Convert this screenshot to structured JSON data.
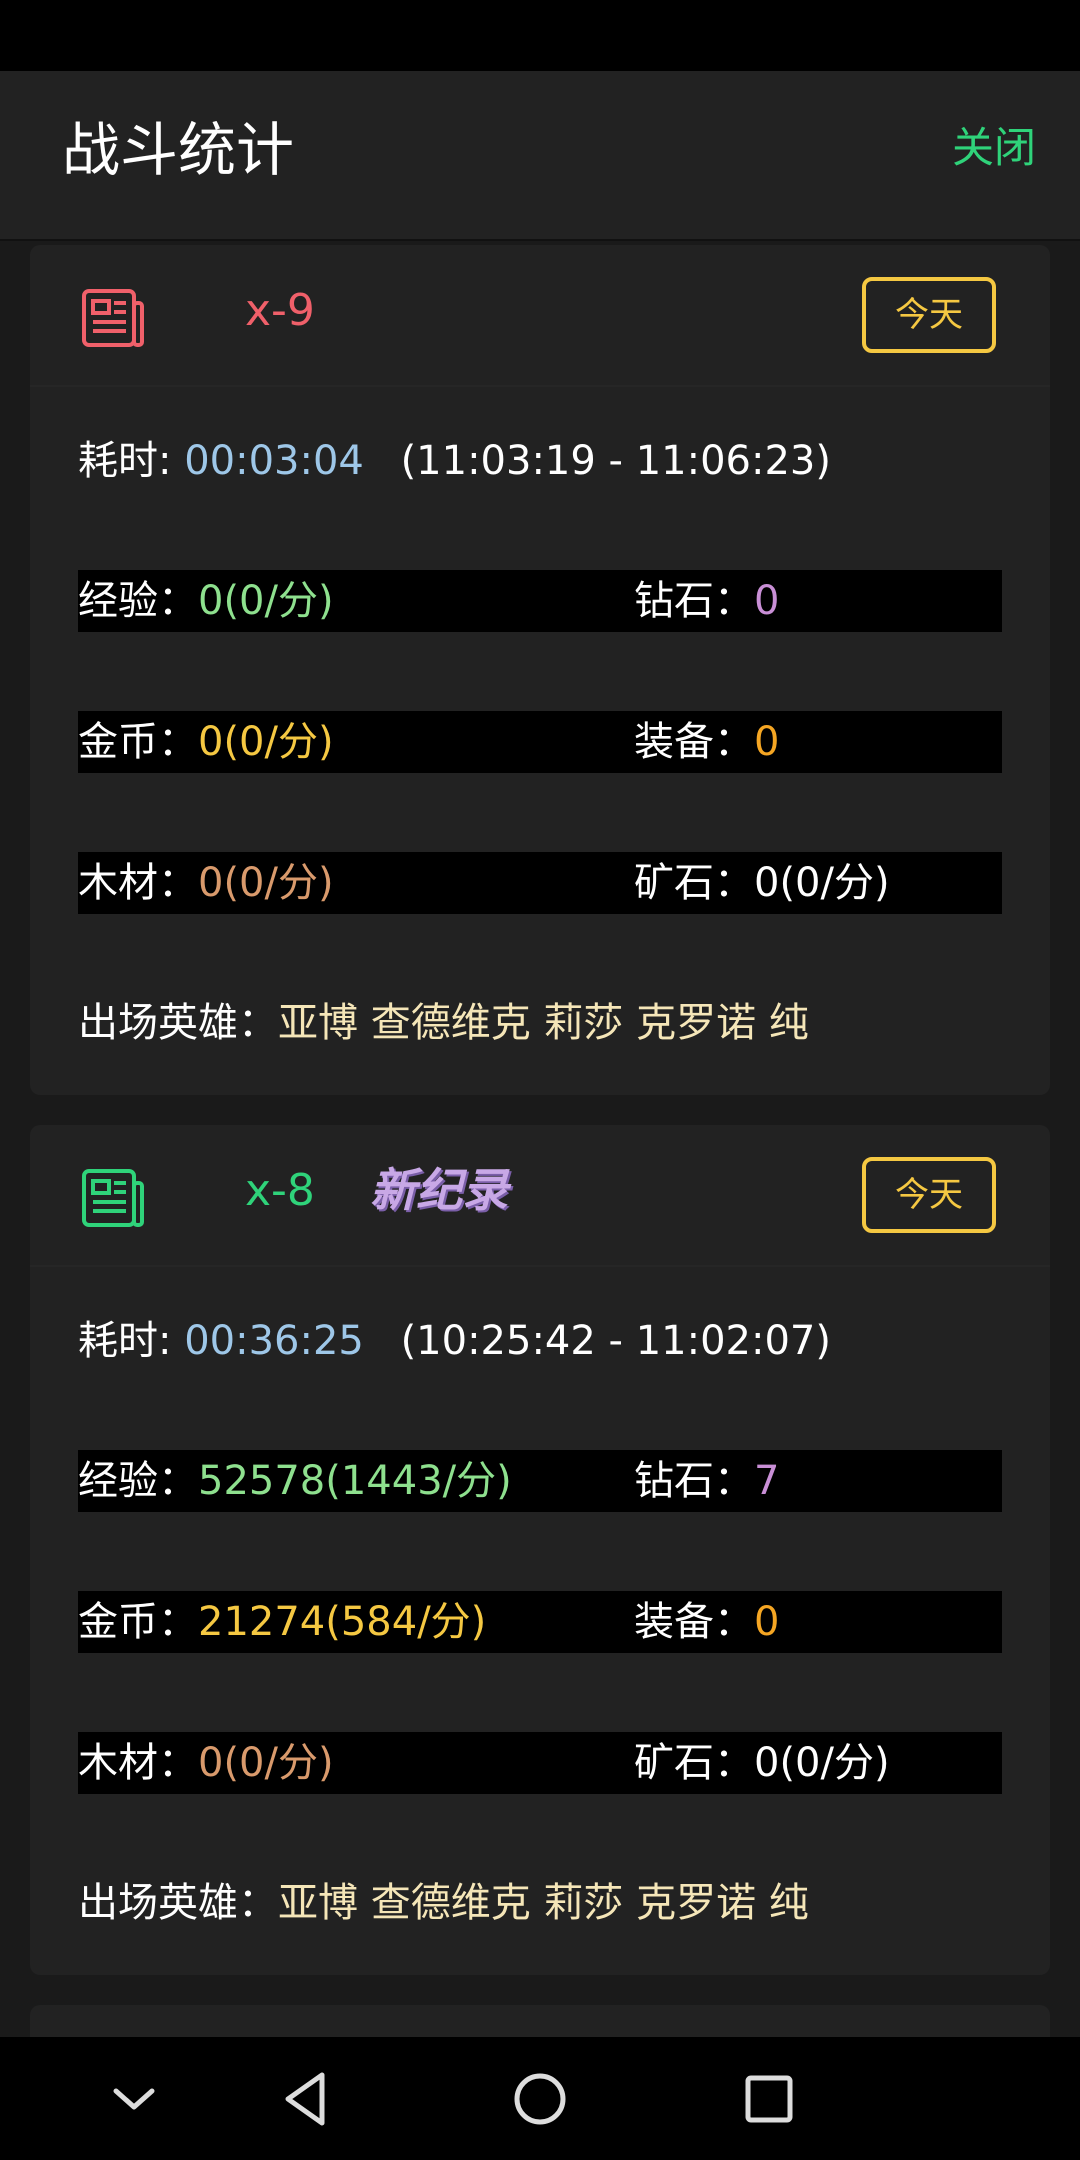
{
  "header": {
    "title": "战斗统计",
    "close_label": "关闭"
  },
  "colors": {
    "accent_green": "#2fd37a",
    "level_red": "#f0606a",
    "today_yellow": "#f5c842"
  },
  "cards": [
    {
      "icon": "document-icon",
      "icon_color": "#f0606a",
      "level": "x-9",
      "record_badge": "",
      "today_label": "今天",
      "time_label": "耗时:",
      "duration": "00:03:04",
      "range": "(11:03:19 - 11:06:23)",
      "exp_label": "经验：",
      "exp_value": "0(0/分)",
      "diamond_label": "钻石：",
      "diamond_value": "0",
      "gold_label": "金币：",
      "gold_value": "0(0/分)",
      "equip_label": "装备：",
      "equip_value": "0",
      "wood_label": "木材：",
      "wood_value": "0(0/分)",
      "ore_label": "矿石：",
      "ore_value": "0(0/分)",
      "heroes_label": "出场英雄：",
      "heroes": "亚博 查德维克 莉莎 克罗诺 纯"
    },
    {
      "icon": "document-icon",
      "icon_color": "#2fd37a",
      "level": "x-8",
      "record_badge": "新纪录",
      "today_label": "今天",
      "time_label": "耗时:",
      "duration": "00:36:25",
      "range": "(10:25:42 - 11:02:07)",
      "exp_label": "经验：",
      "exp_value": "52578(1443/分)",
      "diamond_label": "钻石：",
      "diamond_value": "7",
      "gold_label": "金币：",
      "gold_value": "21274(584/分)",
      "equip_label": "装备：",
      "equip_value": "0",
      "wood_label": "木材：",
      "wood_value": "0(0/分)",
      "ore_label": "矿石：",
      "ore_value": "0(0/分)",
      "heroes_label": "出场英雄：",
      "heroes": "亚博 查德维克 莉莎 克罗诺 纯"
    }
  ],
  "navbar": {
    "icons": [
      "chevron-down-icon",
      "back-icon",
      "home-icon",
      "recents-icon"
    ]
  }
}
